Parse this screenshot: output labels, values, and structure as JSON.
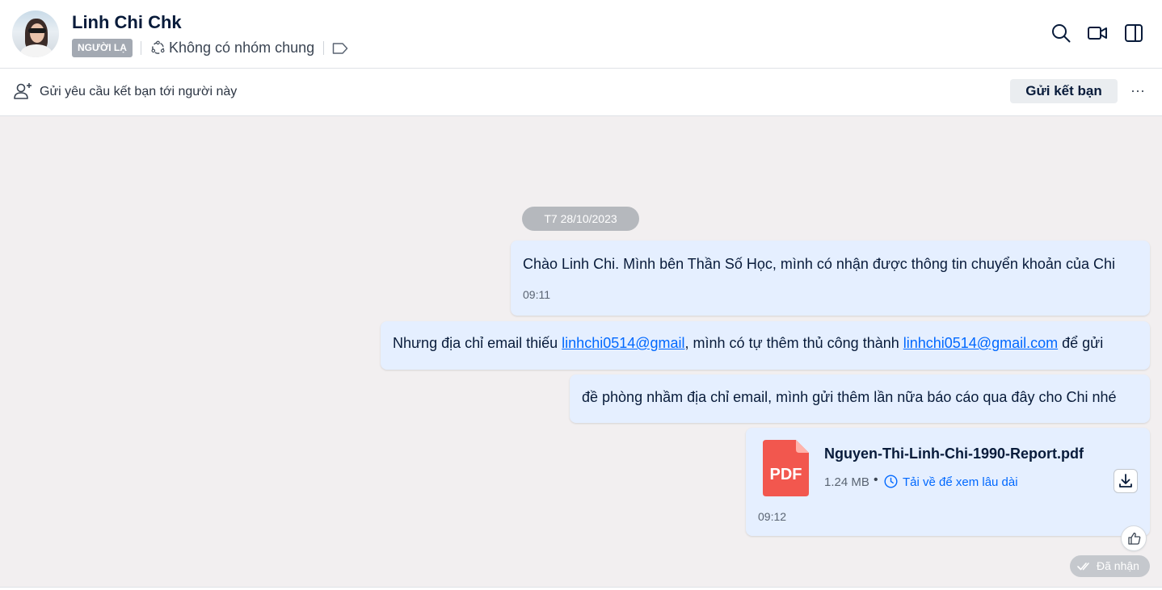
{
  "header": {
    "contact_name": "Linh Chi Chk",
    "stranger_badge": "NGƯỜI LẠ",
    "group_text": "Không có nhóm chung"
  },
  "friend_request": {
    "prompt": "Gửi yêu cầu kết bạn tới người này",
    "button_label": "Gửi kết bạn",
    "more_label": "···"
  },
  "chat": {
    "date_label": "T7 28/10/2023",
    "messages": [
      {
        "text": "Chào Linh Chi. Mình bên Thần Số Học, mình có nhận được thông tin chuyển khoản của Chi",
        "time": "09:11"
      },
      {
        "prefix": "Nhưng địa chỉ email thiếu ",
        "link1": "linhchi0514@gmail",
        "middle": ", mình có tự thêm thủ công thành ",
        "link2": "linhchi0514@gmail.com",
        "suffix": " để gửi"
      },
      {
        "text": "đề phòng nhầm địa chỉ email, mình gửi thêm lần nữa báo cáo qua đây cho Chi nhé"
      }
    ],
    "file": {
      "name": "Nguyen-Thi-Linh-Chi-1990-Report.pdf",
      "icon_label": "PDF",
      "size": "1.24 MB",
      "separator": "•",
      "save_link": "Tải về để xem lâu dài",
      "time": "09:12"
    },
    "status": "Đã nhận"
  },
  "colors": {
    "bubble": "#e5efff",
    "link": "#0068ff",
    "pdf": "#f2574e",
    "background": "#f2eff0"
  },
  "icons": [
    "search-icon",
    "video-call-icon",
    "sidebar-toggle-icon",
    "add-friend-icon",
    "group-icon",
    "tag-icon",
    "clock-icon",
    "download-icon",
    "thumbs-up-icon",
    "double-check-icon"
  ]
}
